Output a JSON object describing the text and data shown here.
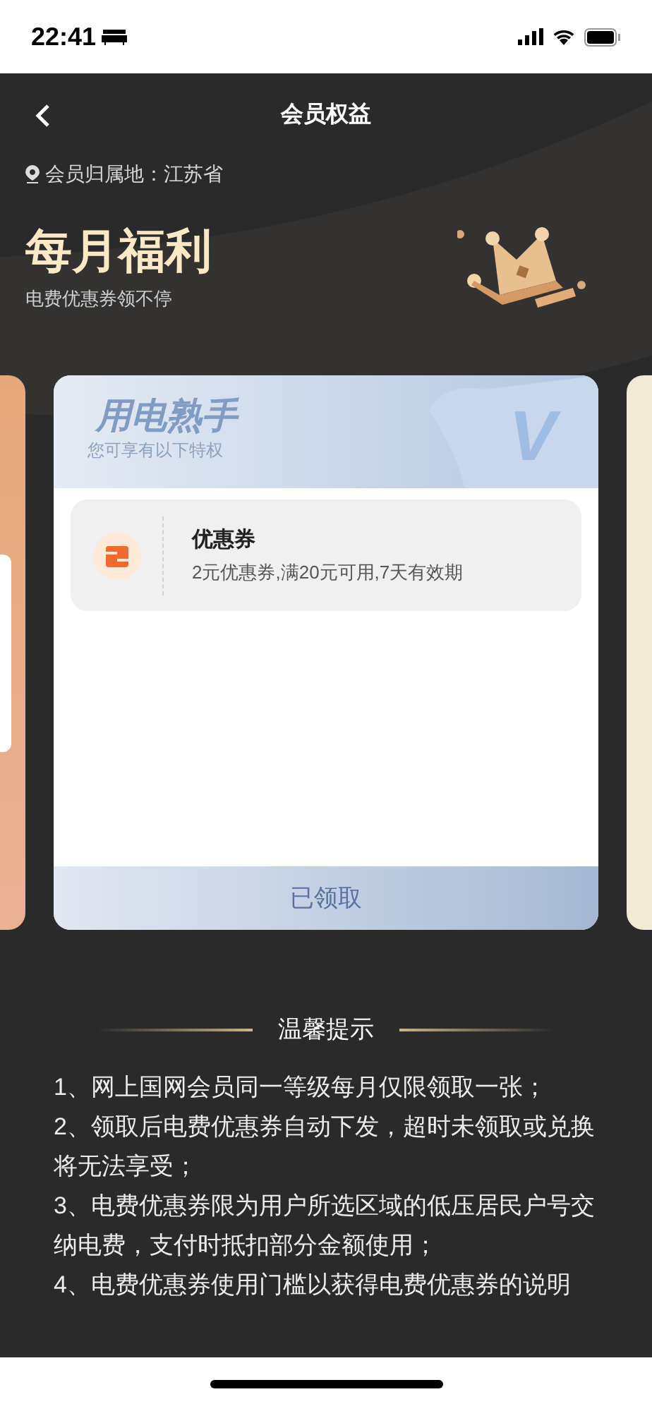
{
  "status_bar": {
    "time": "22:41"
  },
  "header": {
    "title": "会员权益"
  },
  "location": "会员归属地：江苏省",
  "banner": {
    "title": "每月福利",
    "subtitle": "电费优惠券领不停"
  },
  "card": {
    "title": "用电熟手",
    "subtitle": "您可享有以下特权",
    "badge": "V",
    "benefits": [
      {
        "title": "优惠券",
        "description": "2元优惠券,满20元可用,7天有效期"
      }
    ],
    "button": "已领取"
  },
  "tips": {
    "title": "温馨提示",
    "items": [
      "1、网上国网会员同一等级每月仅限领取一张；",
      "2、领取后电费优惠券自动下发，超时未领取或兑换将无法享受；",
      "3、电费优惠券限为用户所选区域的低压居民户号交纳电费，支付时抵扣部分金额使用；",
      "4、电费优惠券使用门槛以获得电费优惠券的说明"
    ]
  }
}
